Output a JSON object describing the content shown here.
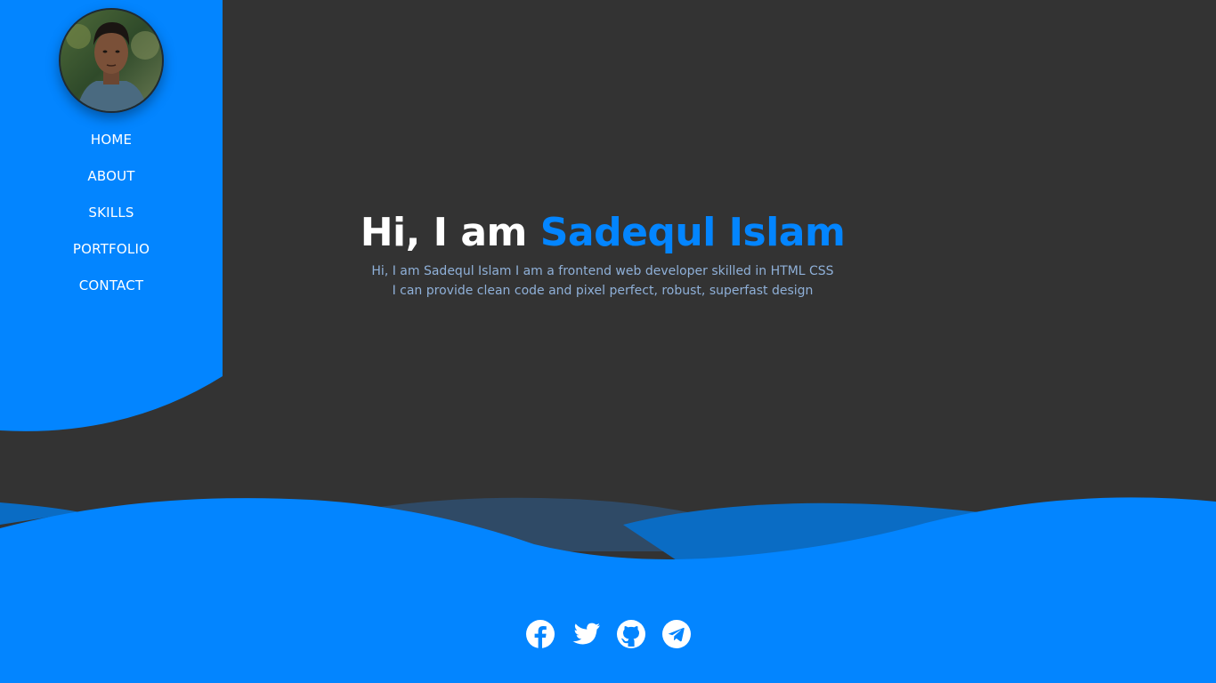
{
  "colors": {
    "accent": "#0385ff",
    "background": "#333333",
    "text_light": "#ffffff",
    "text_muted": "#8fb0d8"
  },
  "sidebar": {
    "avatar_icon": "profile-photo",
    "nav": [
      {
        "label": "HOME"
      },
      {
        "label": "ABOUT"
      },
      {
        "label": "SKILLS"
      },
      {
        "label": "PORTFOLIO"
      },
      {
        "label": "CONTACT"
      }
    ]
  },
  "hero": {
    "greeting": "Hi, I am ",
    "name": "Sadequl Islam",
    "line1": "Hi, I am Sadequl Islam I am a frontend web developer skilled in HTML CSS",
    "line2": "I can provide clean code and pixel perfect, robust, superfast design"
  },
  "socials": [
    {
      "icon": "facebook-icon"
    },
    {
      "icon": "twitter-icon"
    },
    {
      "icon": "github-icon"
    },
    {
      "icon": "telegram-icon"
    }
  ]
}
